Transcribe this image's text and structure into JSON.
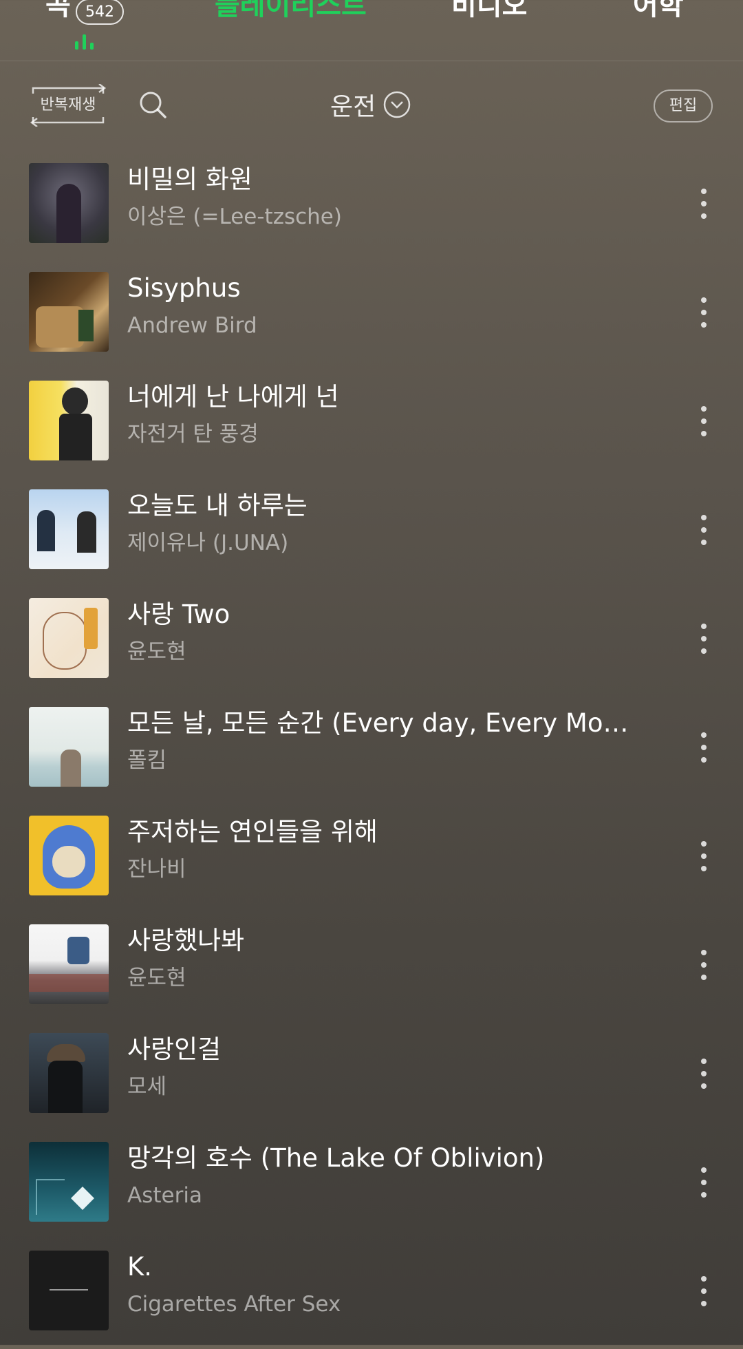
{
  "tabs": {
    "songs": "곡",
    "songs_count": "542",
    "playlist": "플레이리스트",
    "video": "비디오",
    "language": "어학"
  },
  "toolbar": {
    "repeat_label": "반복재생",
    "playlist_name": "운전",
    "edit_label": "편집"
  },
  "colors": {
    "accent": "#1fd15b"
  },
  "songs": [
    {
      "title": "비밀의 화원",
      "artist": "이상은 (=Lee-tzsche)"
    },
    {
      "title": "Sisyphus",
      "artist": "Andrew Bird"
    },
    {
      "title": "너에게 난 나에게 넌",
      "artist": "자전거 탄 풍경"
    },
    {
      "title": "오늘도 내 하루는",
      "artist": "제이유나 (J.UNA)"
    },
    {
      "title": "사랑 Two",
      "artist": "윤도현"
    },
    {
      "title": "모든 날, 모든 순간 (Every day, Every Moment)",
      "artist": "폴킴"
    },
    {
      "title": "주저하는 연인들을 위해",
      "artist": "잔나비"
    },
    {
      "title": "사랑했나봐",
      "artist": "윤도현"
    },
    {
      "title": "사랑인걸",
      "artist": "모세"
    },
    {
      "title": "망각의 호수 (The Lake Of Oblivion)",
      "artist": "Asteria"
    },
    {
      "title": "K.",
      "artist": "Cigarettes After Sex"
    }
  ]
}
